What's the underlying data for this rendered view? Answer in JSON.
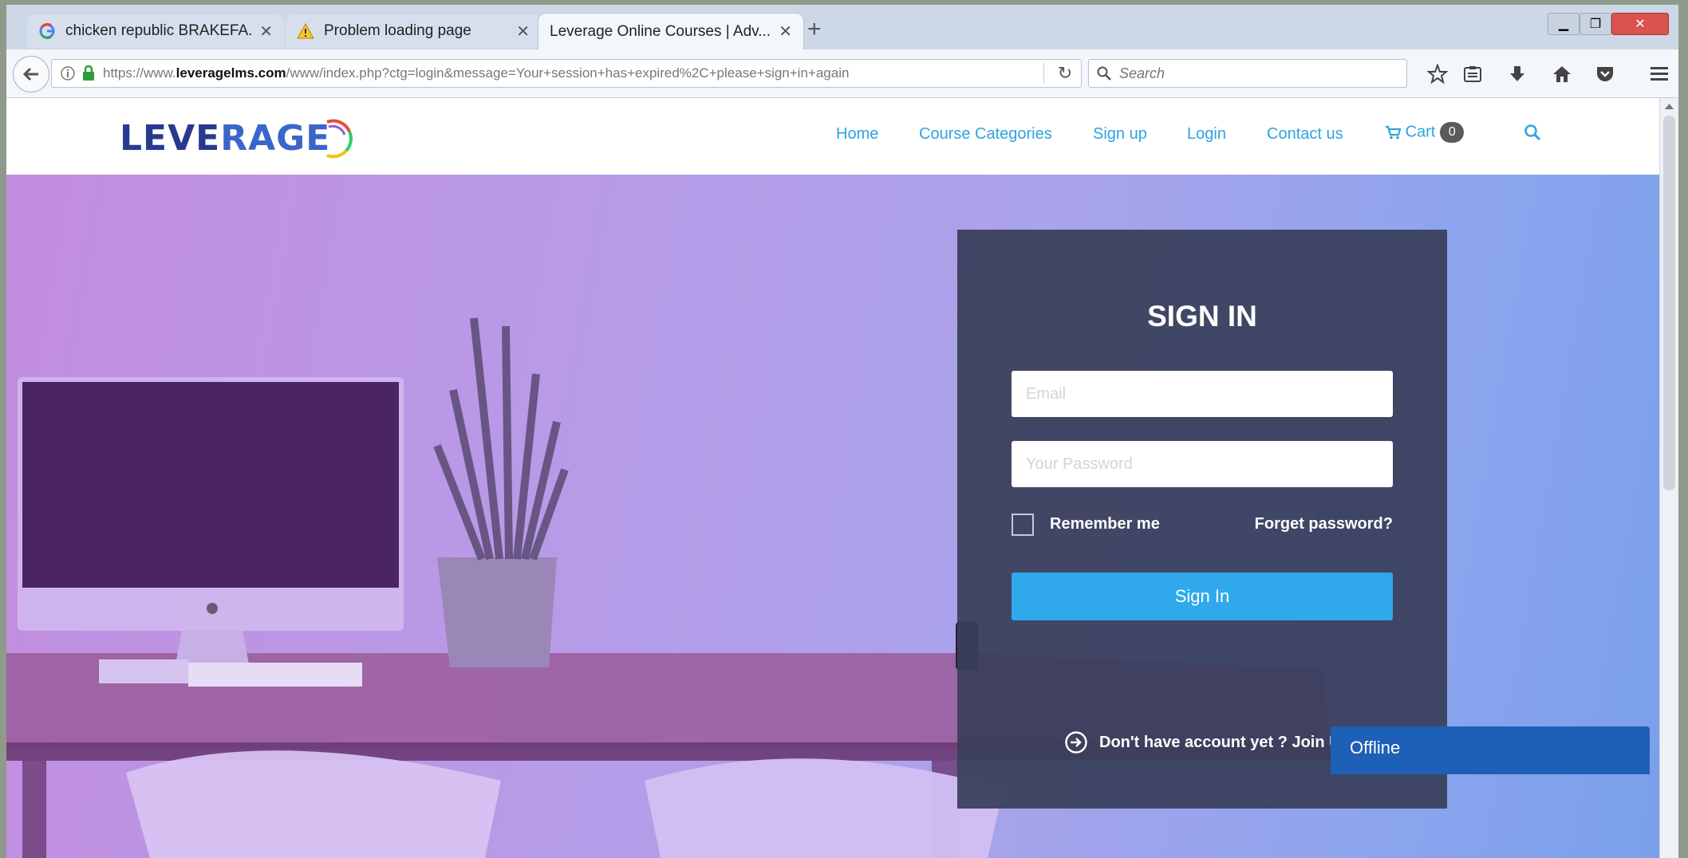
{
  "browser": {
    "tabs": [
      {
        "label": "chicken republic BRAKEFA...",
        "icon": "google-icon",
        "active": false
      },
      {
        "label": "Problem loading page",
        "icon": "warning-icon",
        "active": false
      },
      {
        "label": "Leverage Online Courses | Adv...",
        "icon": "none",
        "active": true
      }
    ],
    "new_tab": "+",
    "url": {
      "prefix": "https://www.",
      "domain": "leveragelms.com",
      "path": "/www/index.php?ctg=login&message=Your+session+has+expired%2C+please+sign+in+again"
    },
    "search_placeholder": "Search"
  },
  "site": {
    "logo": {
      "part1": "LEVE",
      "part2": "RAGE"
    },
    "nav": {
      "home": "Home",
      "categories": "Course Categories",
      "signup": "Sign up",
      "login": "Login",
      "contact": "Contact us",
      "cart": "Cart",
      "cart_count": "0"
    }
  },
  "login": {
    "title": "SIGN IN",
    "email_placeholder": "Email",
    "password_placeholder": "Your Password",
    "remember": "Remember me",
    "forgot": "Forget password?",
    "submit": "Sign In",
    "join": "Don't have account yet ? Join Us"
  },
  "chat": {
    "label": "Offline"
  },
  "colors": {
    "accent": "#2fa9ec",
    "nav_link": "#2ea3e0",
    "card_bg": "#393e5a",
    "logo": "#2a3990"
  }
}
